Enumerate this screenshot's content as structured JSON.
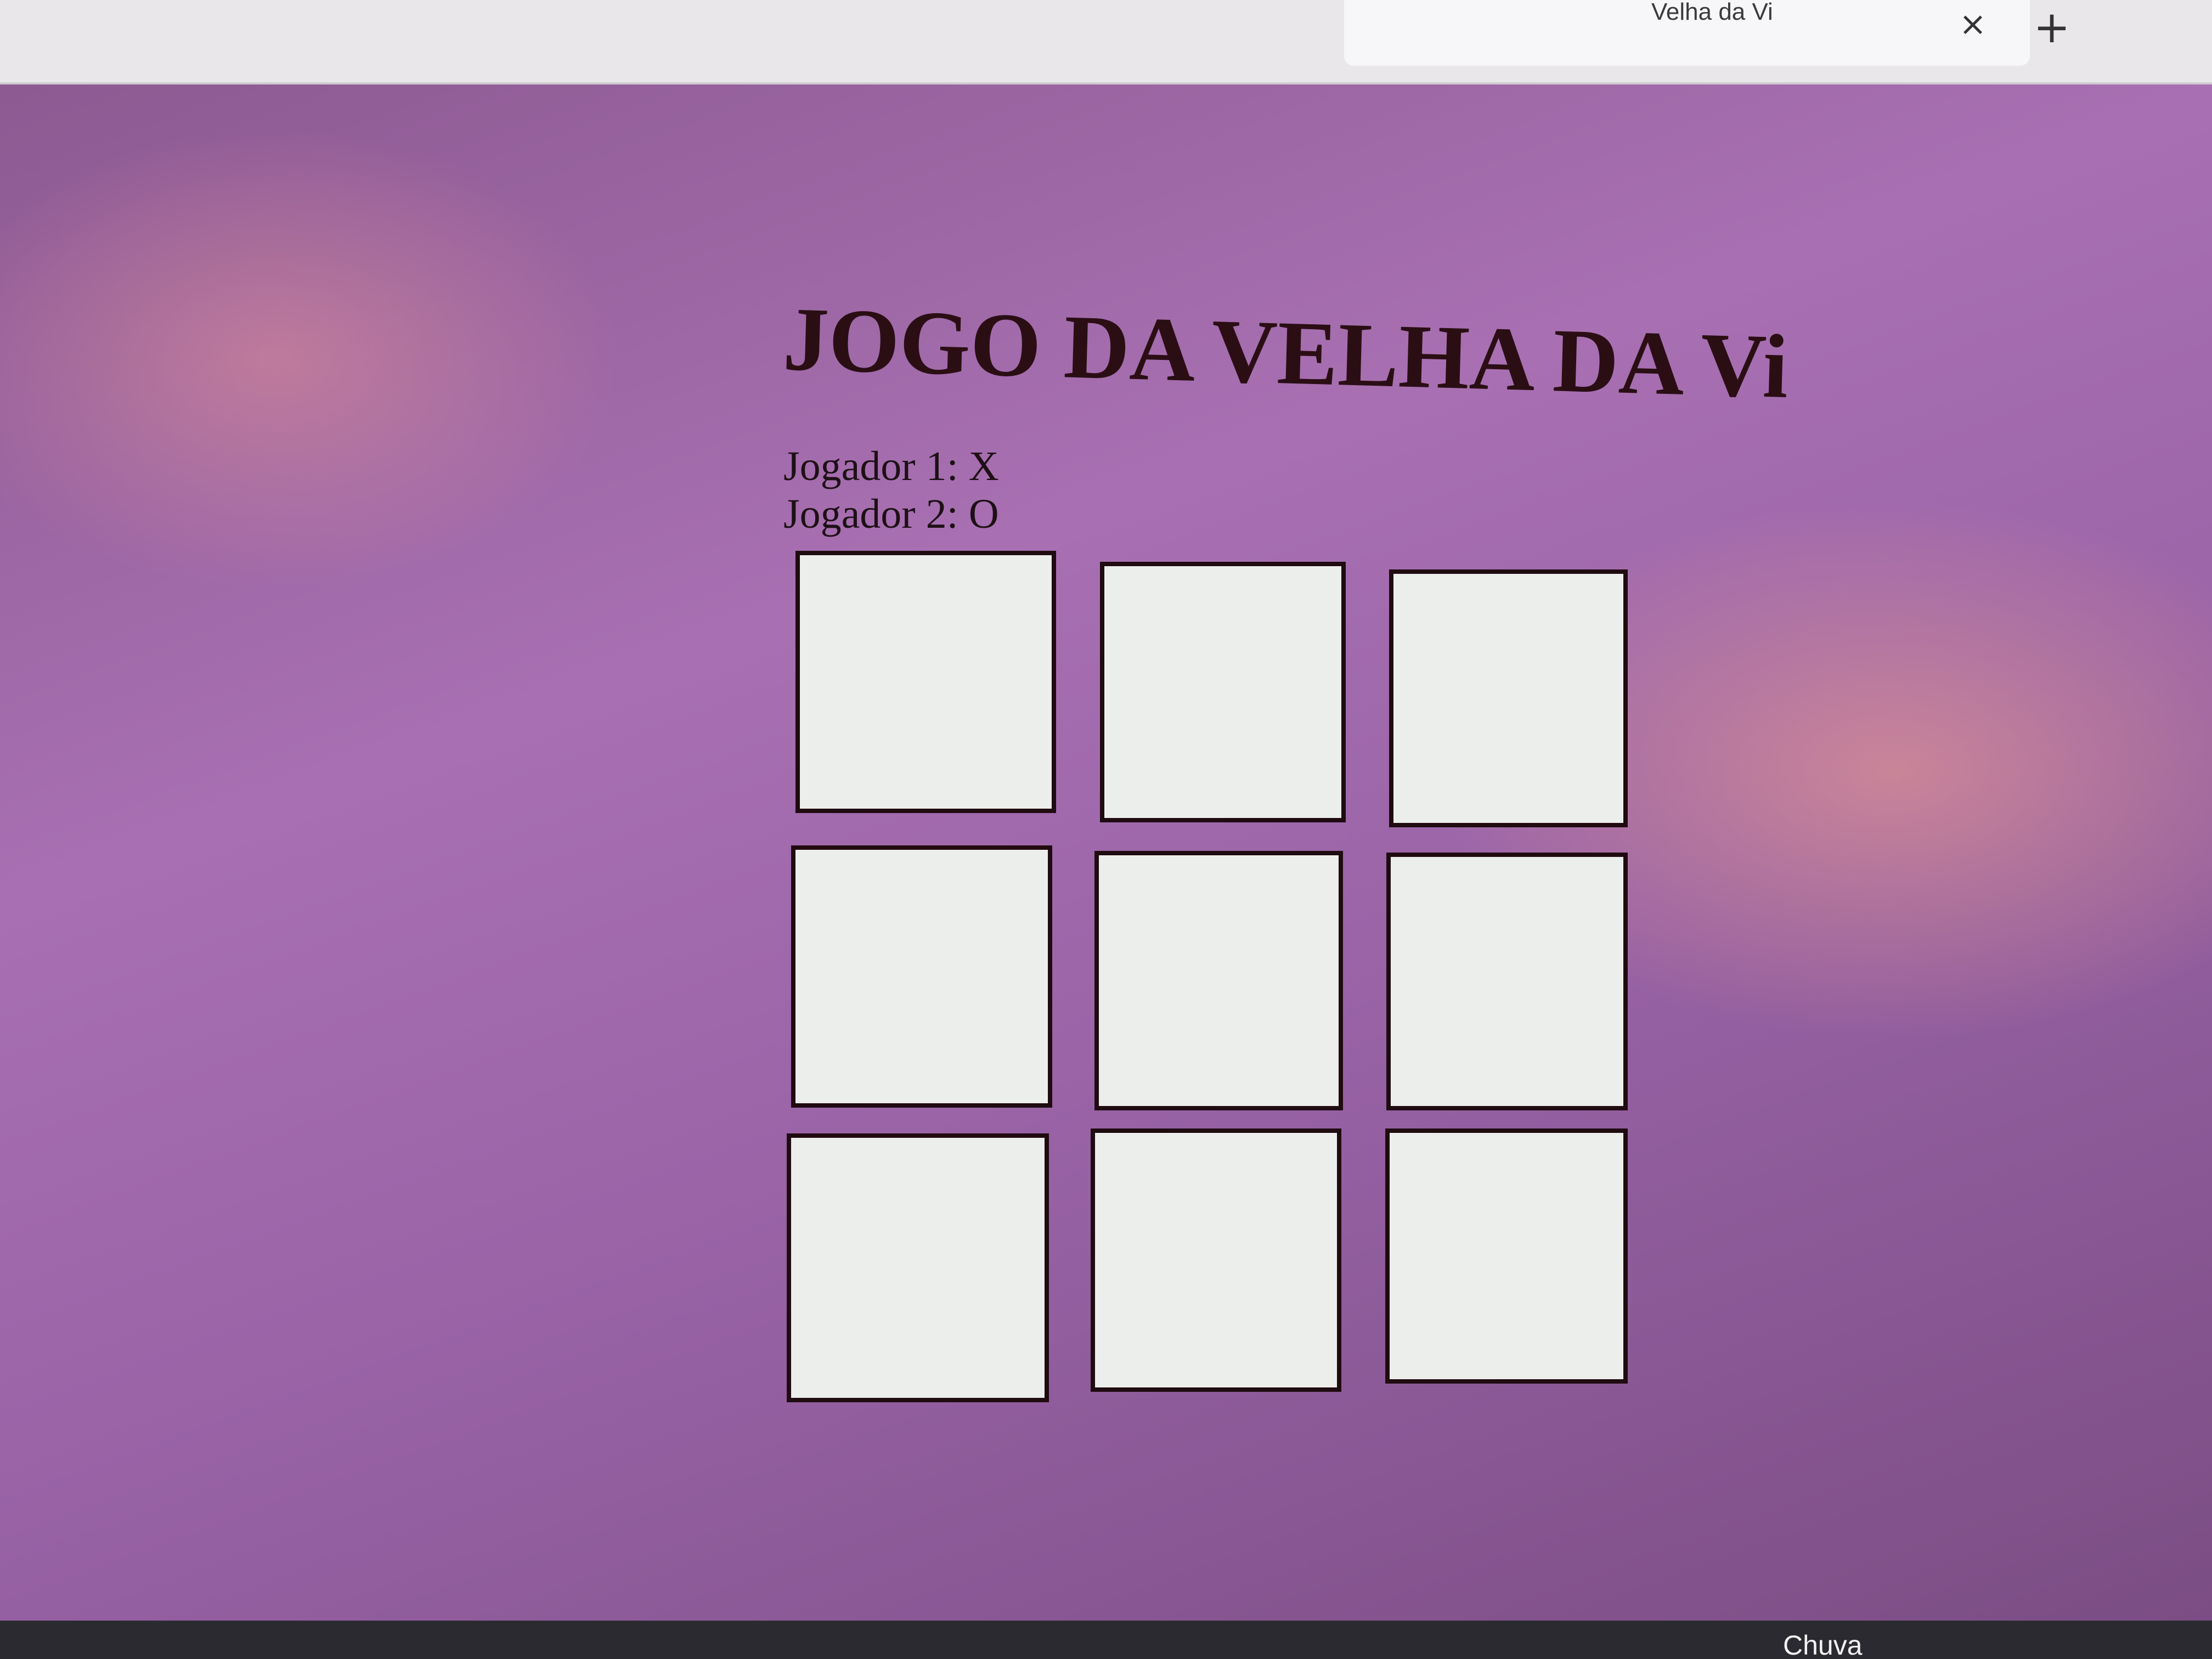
{
  "browser": {
    "tab_title": "Velha da Vi",
    "close_tab_glyph": "×",
    "new_tab_glyph": "+"
  },
  "page": {
    "title": "JOGO DA VELHA DA Vi",
    "players": [
      {
        "label": "Jogador 1: X"
      },
      {
        "label": "Jogador 2: O"
      }
    ]
  },
  "board": {
    "cells": [
      "",
      "",
      "",
      "",
      "",
      "",
      "",
      "",
      ""
    ]
  },
  "taskbar": {
    "weather": "Chuva"
  },
  "colors": {
    "background": "#a870b2",
    "cell_fill": "#eceeeb",
    "cell_border": "#1f0b10",
    "title_text": "#2a0e14"
  }
}
